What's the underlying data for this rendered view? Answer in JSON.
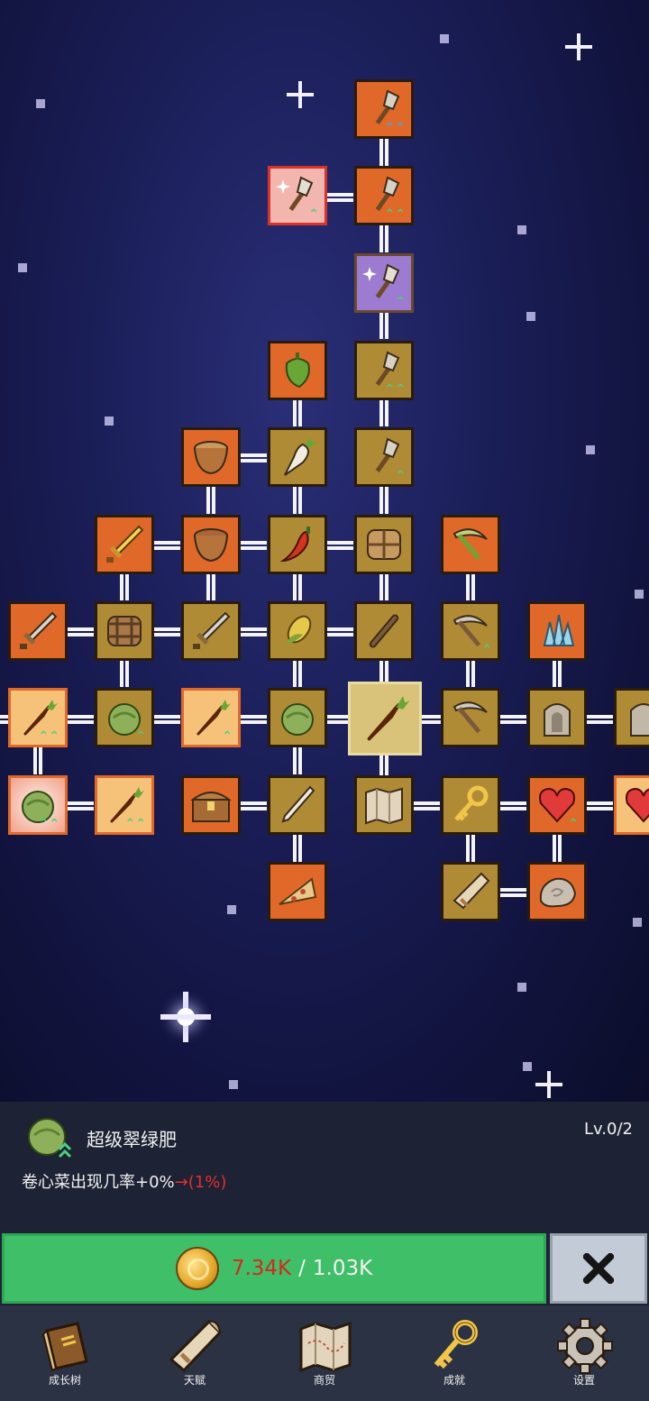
{
  "tree": {
    "nodes": [
      {
        "id": "shovel-top",
        "icon": "shovel-icon",
        "style": "orange"
      },
      {
        "id": "shovel-2",
        "icon": "shovel-icon",
        "style": "orange"
      },
      {
        "id": "shovel-sparkle",
        "icon": "sparkle-shovel-icon",
        "style": "pink"
      },
      {
        "id": "shovel-purple",
        "icon": "sparkle-shovel-icon",
        "style": "purple"
      },
      {
        "id": "pepper",
        "icon": "pepper-icon",
        "style": "orange"
      },
      {
        "id": "shovel-4",
        "icon": "shovel-icon",
        "style": "gold"
      },
      {
        "id": "bowl-1",
        "icon": "bowl-icon",
        "style": "orange"
      },
      {
        "id": "radish",
        "icon": "radish-icon",
        "style": "gold"
      },
      {
        "id": "shovel-5",
        "icon": "shovel-icon",
        "style": "gold"
      },
      {
        "id": "sword-gold",
        "icon": "sword-icon",
        "style": "orange"
      },
      {
        "id": "bowl-2",
        "icon": "bowl-icon",
        "style": "orange"
      },
      {
        "id": "chili",
        "icon": "chili-icon",
        "style": "gold"
      },
      {
        "id": "basket-1",
        "icon": "basket-icon",
        "style": "gold"
      },
      {
        "id": "pickaxe-green",
        "icon": "pickaxe-icon",
        "style": "orange"
      },
      {
        "id": "sword-1",
        "icon": "sword-icon",
        "style": "orange"
      },
      {
        "id": "basket-2",
        "icon": "basket-icon",
        "style": "gold"
      },
      {
        "id": "sword-2",
        "icon": "sword-icon",
        "style": "gold"
      },
      {
        "id": "corn",
        "icon": "corn-icon",
        "style": "gold"
      },
      {
        "id": "stick",
        "icon": "stick-icon",
        "style": "gold"
      },
      {
        "id": "pickaxe-2",
        "icon": "pickaxe-icon",
        "style": "gold"
      },
      {
        "id": "crystal",
        "icon": "crystal-icon",
        "style": "orange"
      },
      {
        "id": "carrot-1",
        "icon": "carrot-icon",
        "style": "orangeframe"
      },
      {
        "id": "cabbage-1",
        "icon": "cabbage-icon",
        "style": "gold"
      },
      {
        "id": "carrot-2",
        "icon": "carrot-icon",
        "style": "orangeframe"
      },
      {
        "id": "cabbage-2",
        "icon": "cabbage-icon",
        "style": "gold"
      },
      {
        "id": "carrot-center",
        "icon": "carrot-icon",
        "style": "sel"
      },
      {
        "id": "pickaxe-3",
        "icon": "pickaxe-icon",
        "style": "gold"
      },
      {
        "id": "statue-1",
        "icon": "statue-icon",
        "style": "gold"
      },
      {
        "id": "statue-2",
        "icon": "statue-icon",
        "style": "gold"
      },
      {
        "id": "cabbage-selected",
        "icon": "cabbage-icon",
        "style": "pink"
      },
      {
        "id": "carrot-3",
        "icon": "carrot-icon",
        "style": "orangeframe"
      },
      {
        "id": "chest",
        "icon": "chest-icon",
        "style": "orange"
      },
      {
        "id": "leek",
        "icon": "leek-icon",
        "style": "gold"
      },
      {
        "id": "map",
        "icon": "map-icon",
        "style": "gold"
      },
      {
        "id": "key",
        "icon": "key-icon",
        "style": "gold"
      },
      {
        "id": "heart-1",
        "icon": "heart-icon",
        "style": "orange"
      },
      {
        "id": "heart-2",
        "icon": "heart-icon",
        "style": "orange"
      },
      {
        "id": "pizza",
        "icon": "pizza-icon",
        "style": "orange"
      },
      {
        "id": "scroll",
        "icon": "scroll-icon",
        "style": "gold"
      },
      {
        "id": "stone",
        "icon": "stone-icon",
        "style": "orange"
      }
    ]
  },
  "detail": {
    "icon": "cabbage-icon",
    "name": "超级翠绿肥",
    "level": "Lv.0/2",
    "desc_prefix": "卷心菜出现几率+0%",
    "desc_arrow": "→",
    "desc_next": "(1%)"
  },
  "purchase": {
    "coin_icon": "coin-icon",
    "have": "7.34K",
    "separator": "/",
    "need": "1.03K",
    "close_icon": "close-icon"
  },
  "nav": [
    {
      "label": "成长树",
      "icon": "book-icon"
    },
    {
      "label": "天赋",
      "icon": "scroll-icon"
    },
    {
      "label": "商贸",
      "icon": "map-icon"
    },
    {
      "label": "成就",
      "icon": "key-icon"
    },
    {
      "label": "设置",
      "icon": "gear-icon"
    }
  ],
  "colors": {
    "upgrade_green": "#3fbf68",
    "cost_red": "#d5281f",
    "node_gold": "#b08b36",
    "node_orange": "#e0692a"
  }
}
